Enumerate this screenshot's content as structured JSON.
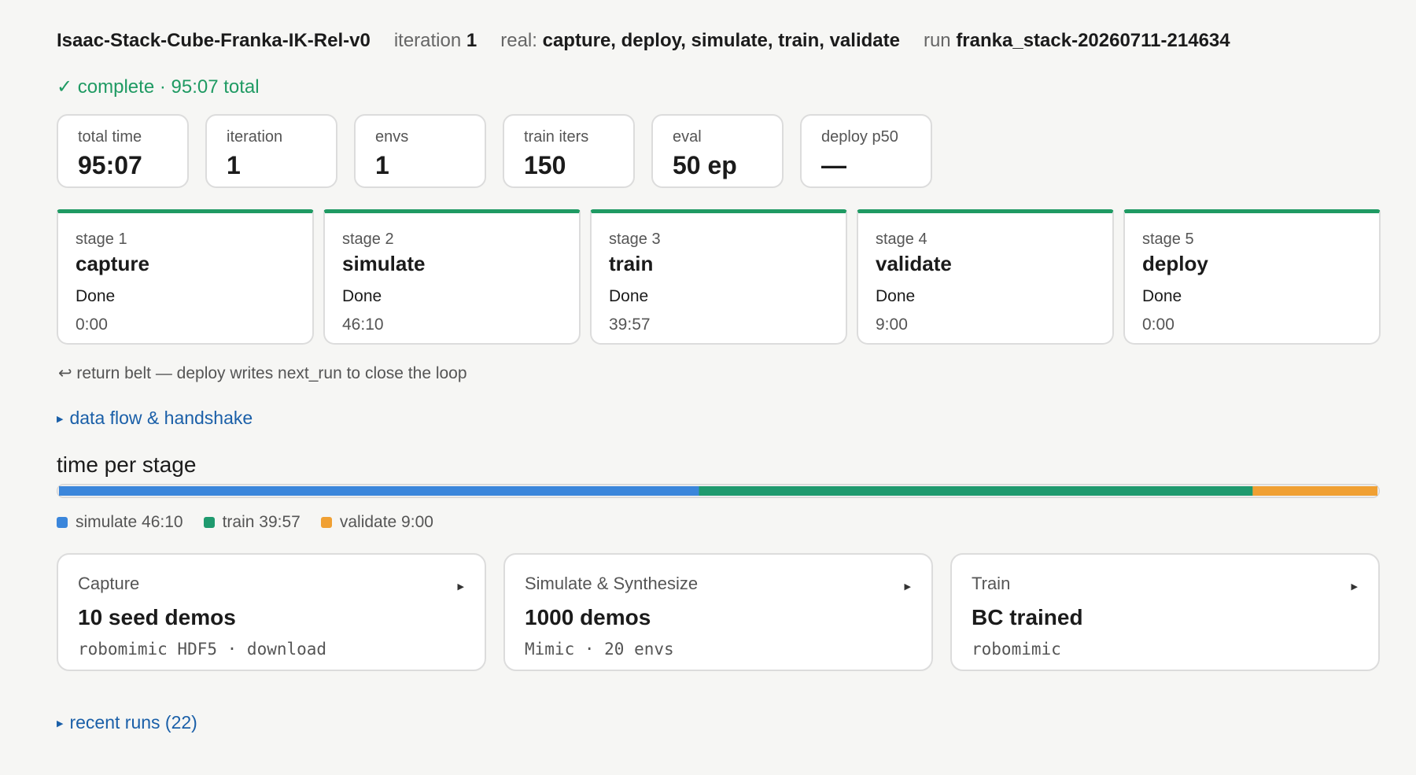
{
  "header": {
    "task": "Isaac-Stack-Cube-Franka-IK-Rel-v0",
    "iteration_label": "iteration",
    "iteration_value": "1",
    "real_label": "real:",
    "real_value": "capture, deploy, simulate, train, validate",
    "run_label": "run",
    "run_value": "franka_stack-20260711-214634"
  },
  "status": {
    "check": "✓",
    "text": "complete · 95:07 total"
  },
  "kpis": [
    {
      "label": "total time",
      "value": "95:07"
    },
    {
      "label": "iteration",
      "value": "1"
    },
    {
      "label": "envs",
      "value": "1"
    },
    {
      "label": "train iters",
      "value": "150"
    },
    {
      "label": "eval",
      "value": "50 ep"
    },
    {
      "label": "deploy p50",
      "value": "—"
    }
  ],
  "stages": [
    {
      "num": "stage 1",
      "name": "capture",
      "state": "Done",
      "duration": "0:00"
    },
    {
      "num": "stage 2",
      "name": "simulate",
      "state": "Done",
      "duration": "46:10"
    },
    {
      "num": "stage 3",
      "name": "train",
      "state": "Done",
      "duration": "39:57"
    },
    {
      "num": "stage 4",
      "name": "validate",
      "state": "Done",
      "duration": "9:00"
    },
    {
      "num": "stage 5",
      "name": "deploy",
      "state": "Done",
      "duration": "0:00"
    }
  ],
  "return_note": "↩ return belt — deploy writes next_run to close the loop",
  "data_flow_link": "data flow & handshake",
  "time_per_stage": {
    "title": "time per stage",
    "segments": [
      {
        "name": "simulate",
        "label": "simulate 46:10",
        "seconds": 2770,
        "color": "#3b86db"
      },
      {
        "name": "train",
        "label": "train 39:57",
        "seconds": 2397,
        "color": "#1f9a6e"
      },
      {
        "name": "validate",
        "label": "validate 9:00",
        "seconds": 540,
        "color": "#f0a033"
      }
    ]
  },
  "cards": [
    {
      "title": "Capture",
      "value": "10 seed demos",
      "sub": "robomimic HDF5 · download"
    },
    {
      "title": "Simulate & Synthesize",
      "value": "1000 demos",
      "sub": "Mimic · 20 envs"
    },
    {
      "title": "Train",
      "value": "BC trained",
      "sub": "robomimic"
    }
  ],
  "recent_runs_link": "recent runs (22)",
  "icons": {
    "expand": "triangle-right-icon",
    "status": "check-icon",
    "return": "return-arrow-icon"
  }
}
